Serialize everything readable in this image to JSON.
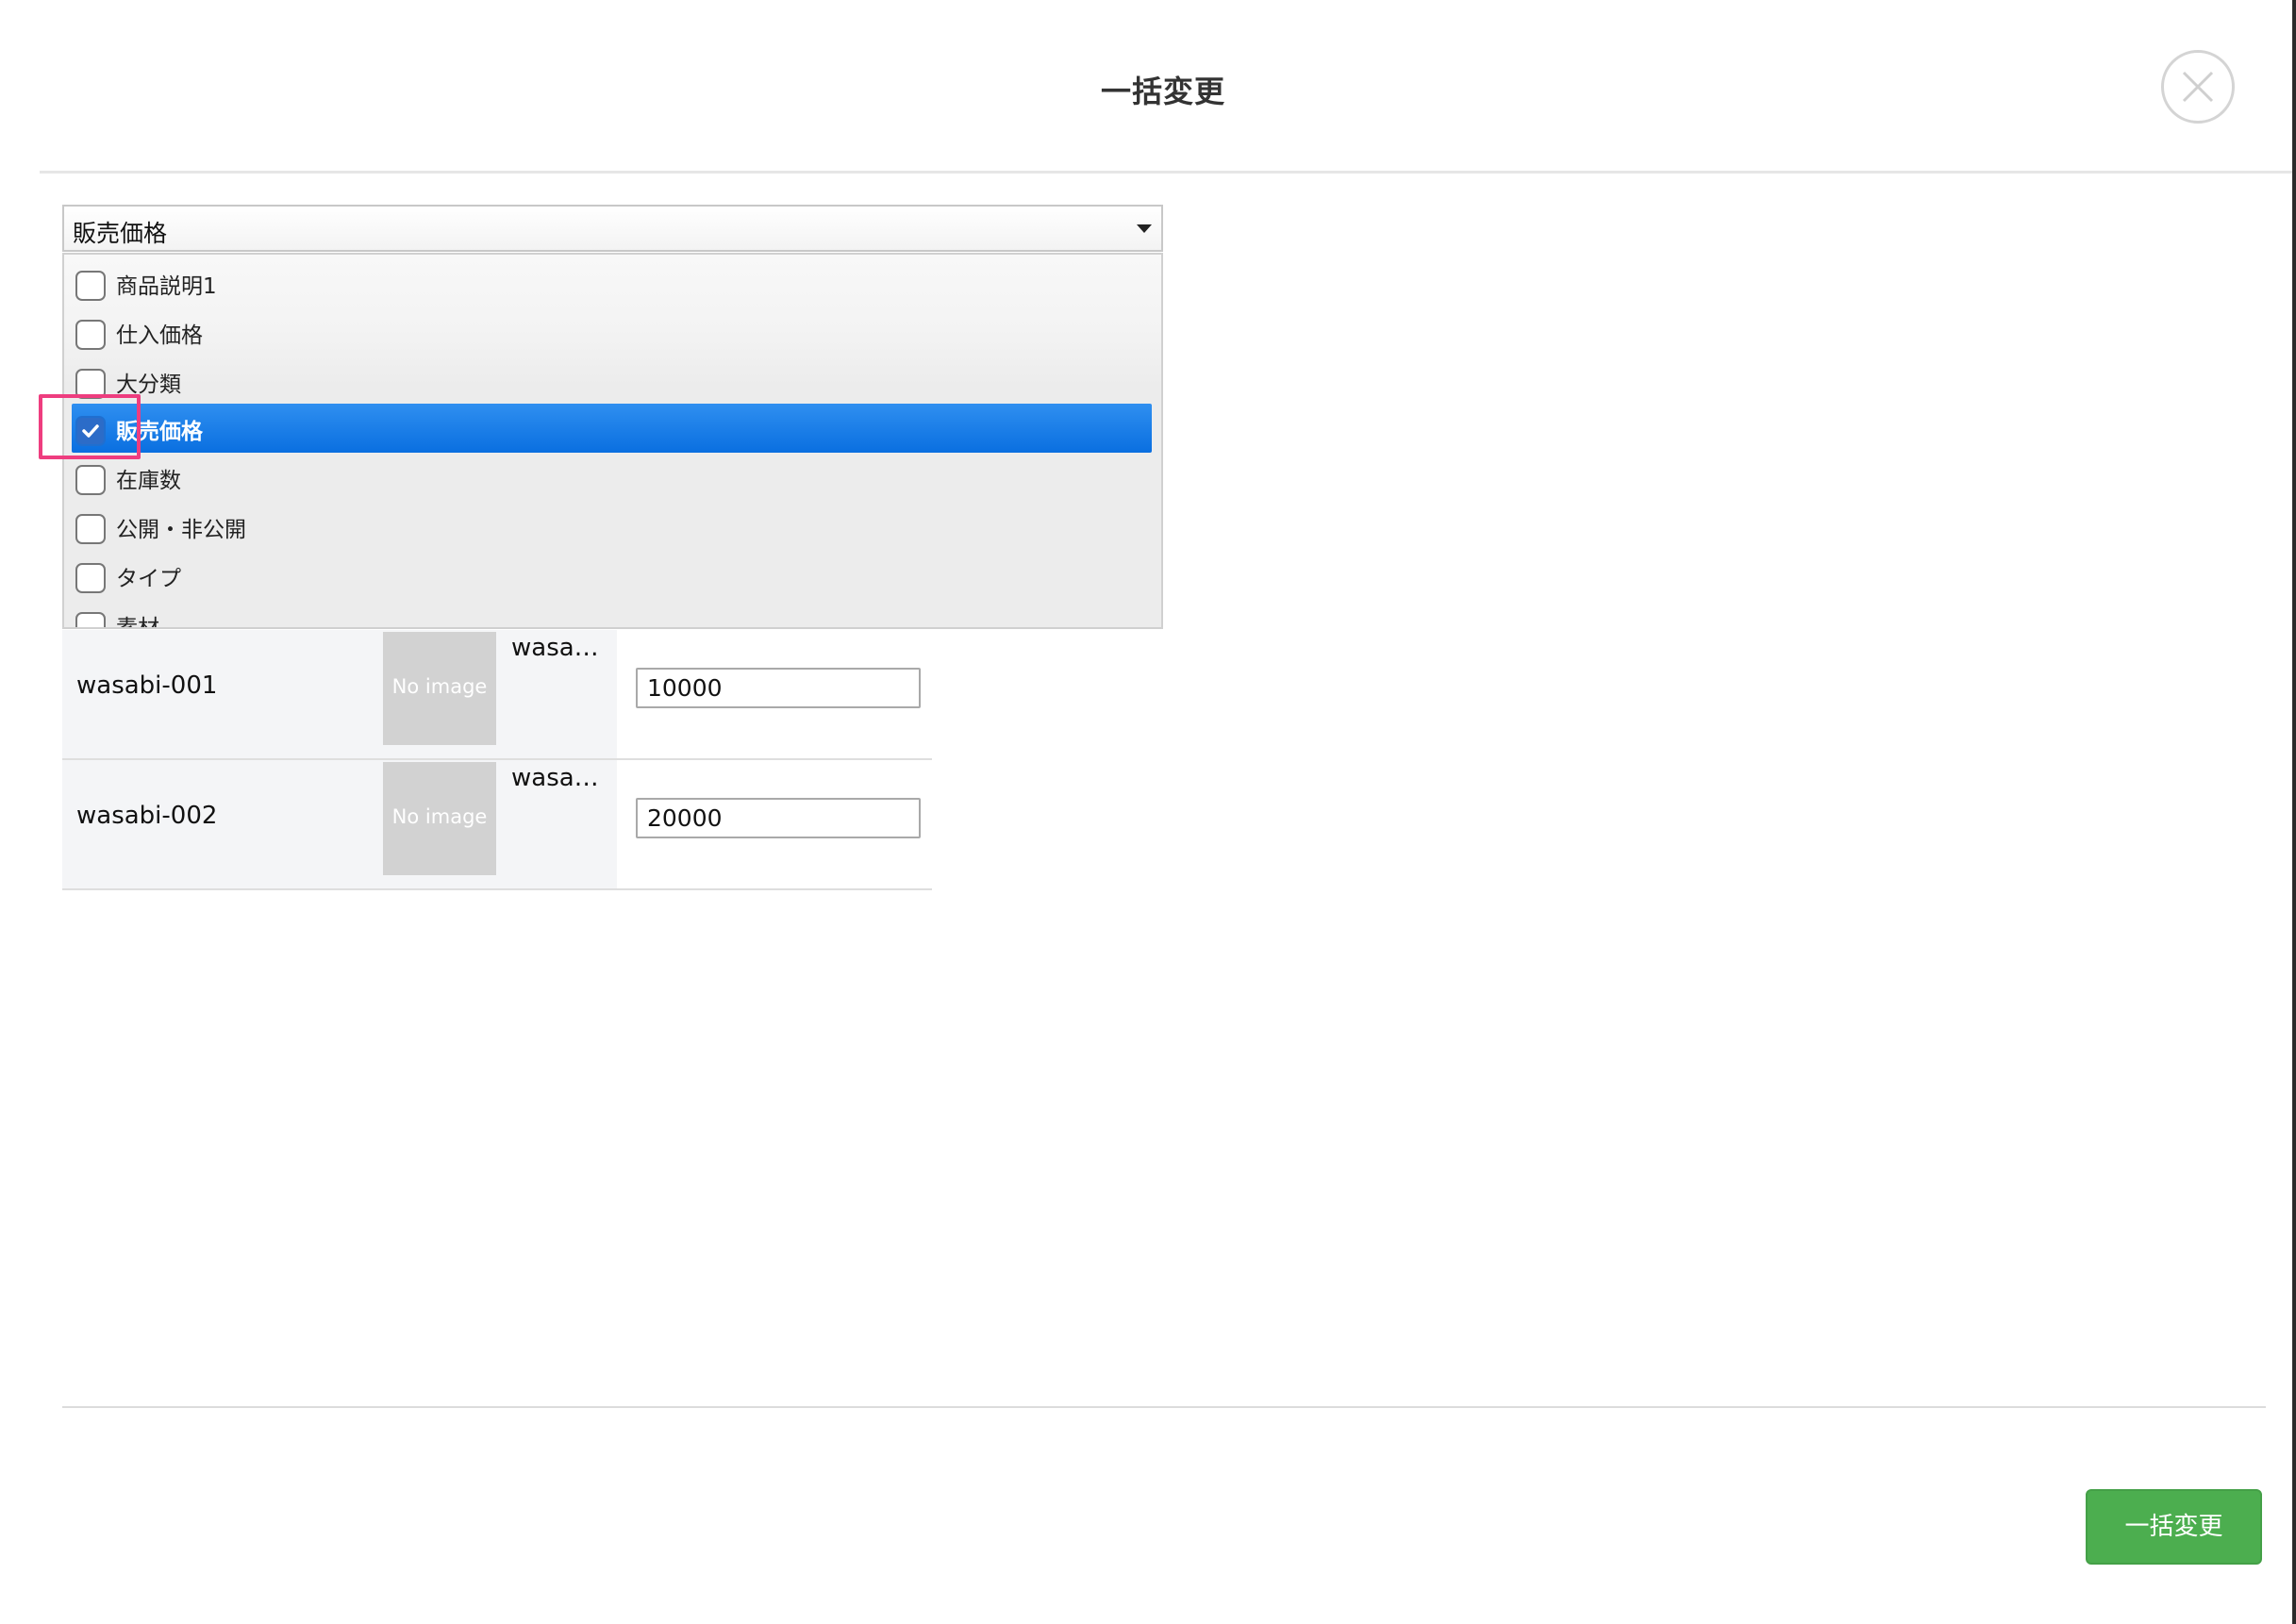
{
  "modal": {
    "title": "一括変更",
    "close_icon": "close-icon"
  },
  "field_select": {
    "selected_value": "販売価格",
    "options": [
      {
        "label": "商品説明1",
        "checked": false
      },
      {
        "label": "仕入価格",
        "checked": false
      },
      {
        "label": "大分類",
        "checked": false
      },
      {
        "label": "販売価格",
        "checked": true
      },
      {
        "label": "在庫数",
        "checked": false
      },
      {
        "label": "公開・非公開",
        "checked": false
      },
      {
        "label": "タイプ",
        "checked": false
      },
      {
        "label": "素材",
        "checked": false
      }
    ]
  },
  "products": [
    {
      "code": "wasabi-001",
      "image_placeholder": "No image",
      "name": "wasa…",
      "price": "10000"
    },
    {
      "code": "wasabi-002",
      "image_placeholder": "No image",
      "name": "wasa…",
      "price": "20000"
    }
  ],
  "footer": {
    "submit_label": "一括変更"
  },
  "colors": {
    "selection_blue": "#0a6fe0",
    "focus_pink": "#ee3d7f",
    "submit_green": "#4cae4f"
  }
}
